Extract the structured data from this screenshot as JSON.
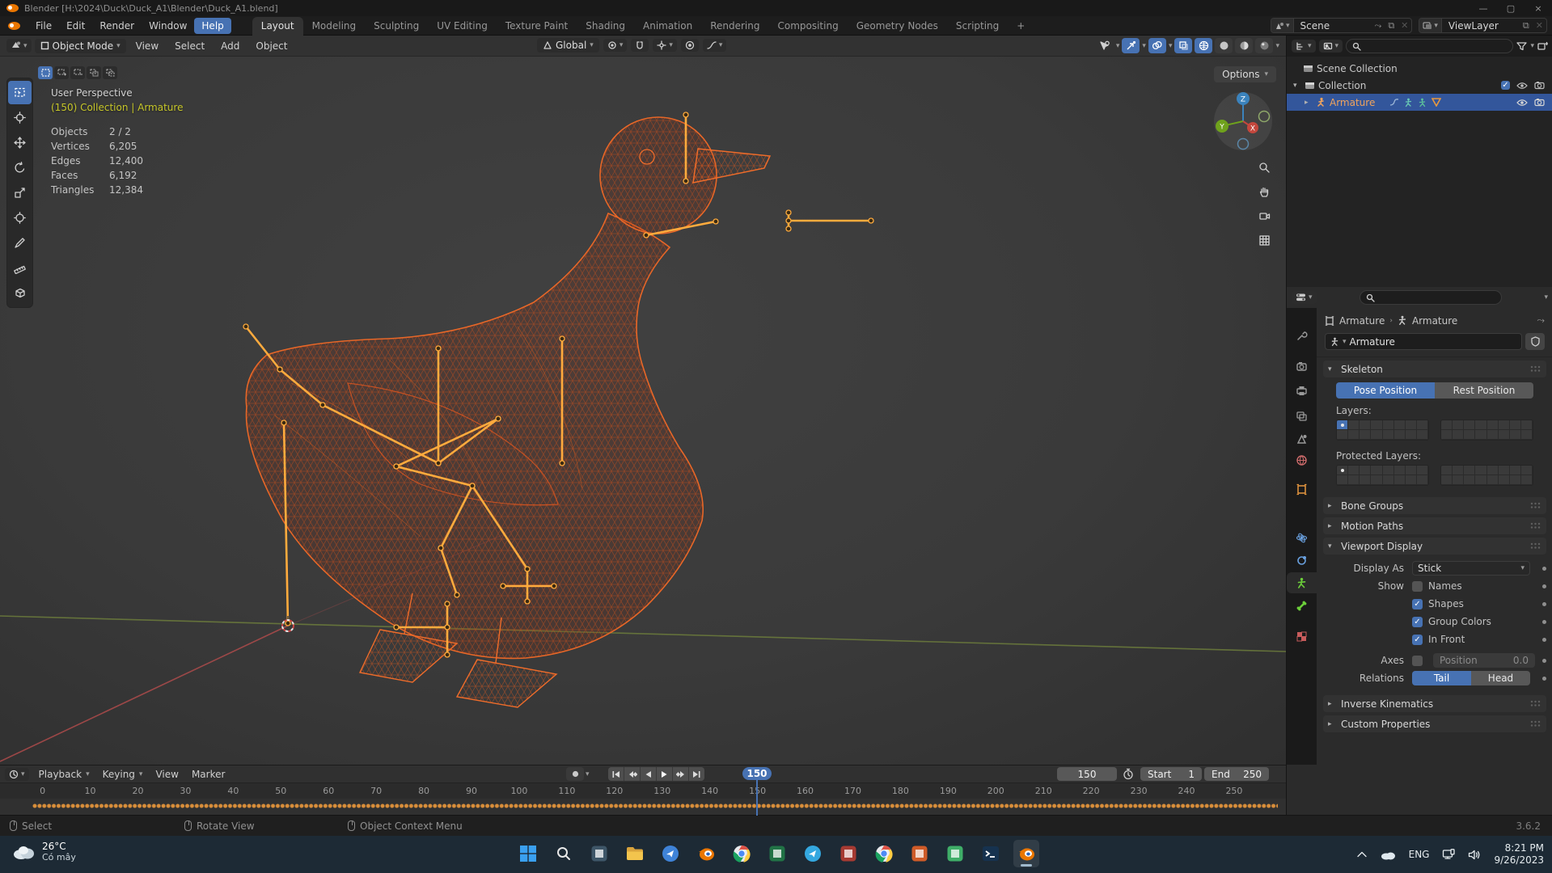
{
  "titlebar": {
    "title": "Blender [H:\\2024\\Duck\\Duck_A1\\Blender\\Duck_A1.blend]"
  },
  "topbar": {
    "menus": [
      "File",
      "Edit",
      "Render",
      "Window",
      "Help"
    ],
    "active_menu": "Help",
    "tabs": [
      "Layout",
      "Modeling",
      "Sculpting",
      "UV Editing",
      "Texture Paint",
      "Shading",
      "Animation",
      "Rendering",
      "Compositing",
      "Geometry Nodes",
      "Scripting",
      "+"
    ],
    "active_tab": "Layout",
    "scene_label": "Scene",
    "view_layer_label": "ViewLayer"
  },
  "viewport": {
    "header": {
      "mode": "Object Mode",
      "menus": [
        "View",
        "Select",
        "Add",
        "Object"
      ],
      "orientation": "Global",
      "options_label": "Options"
    },
    "overlay": {
      "perspective": "User Perspective",
      "context": "(150) Collection | Armature",
      "stats": [
        {
          "label": "Objects",
          "value": "2 / 2"
        },
        {
          "label": "Vertices",
          "value": "6,205"
        },
        {
          "label": "Edges",
          "value": "12,400"
        },
        {
          "label": "Faces",
          "value": "6,192"
        },
        {
          "label": "Triangles",
          "value": "12,384"
        }
      ]
    },
    "gizmo_axes": {
      "z": "Z",
      "y": "Y",
      "x": "X"
    }
  },
  "outliner": {
    "rows": [
      {
        "label": "Scene Collection"
      },
      {
        "label": "Collection"
      },
      {
        "label": "Armature",
        "selected": true
      }
    ]
  },
  "properties": {
    "breadcrumb": {
      "object": "Armature",
      "data": "Armature"
    },
    "name_value": "Armature",
    "skeleton": {
      "title": "Skeleton",
      "pose_label": "Pose Position",
      "rest_label": "Rest Position",
      "layers_label": "Layers:",
      "protected_label": "Protected Layers:"
    },
    "sections": {
      "bone_groups": "Bone Groups",
      "motion_paths": "Motion Paths",
      "inverse_kinematics": "Inverse Kinematics",
      "custom_properties": "Custom Properties"
    },
    "viewport_display": {
      "title": "Viewport Display",
      "display_as_label": "Display As",
      "display_as_value": "Stick",
      "show_label": "Show",
      "checkboxes": [
        {
          "label": "Names",
          "checked": false
        },
        {
          "label": "Shapes",
          "checked": true
        },
        {
          "label": "Group Colors",
          "checked": true
        },
        {
          "label": "In Front",
          "checked": true
        }
      ],
      "axes_label": "Axes",
      "position_label": "Position",
      "position_value": "0.0",
      "relations_label": "Relations",
      "tail_label": "Tail",
      "head_label": "Head"
    },
    "tabs": [
      {
        "name": "tool",
        "color": "#9a9a9a",
        "shape": "wrench"
      },
      {
        "name": "render",
        "color": "#9a9a9a",
        "shape": "camera"
      },
      {
        "name": "output",
        "color": "#9a9a9a",
        "shape": "printer"
      },
      {
        "name": "view-layer",
        "color": "#9a9a9a",
        "shape": "images"
      },
      {
        "name": "scene",
        "color": "#9a9a9a",
        "shape": "cone"
      },
      {
        "name": "world",
        "color": "#cc6a6a",
        "shape": "globe"
      },
      {
        "name": "object",
        "color": "#e8983f",
        "shape": "box"
      },
      {
        "name": "physics",
        "color": "#6aa1e0",
        "shape": "atom"
      },
      {
        "name": "constraints",
        "color": "#6aa1e0",
        "shape": "ring"
      },
      {
        "name": "object-data",
        "color": "#6ccf3a",
        "shape": "man",
        "active": true
      },
      {
        "name": "bone",
        "color": "#6ccf3a",
        "shape": "bone"
      },
      {
        "name": "texture",
        "color": "#c75b5b",
        "shape": "checker"
      }
    ]
  },
  "timeline": {
    "menus": [
      "Playback",
      "Keying",
      "View",
      "Marker"
    ],
    "current_frame": "150",
    "start_label": "Start",
    "start_value": "1",
    "end_label": "End",
    "end_value": "250",
    "playhead_frame": "150",
    "ruler": [
      "0",
      "10",
      "20",
      "30",
      "40",
      "50",
      "60",
      "70",
      "80",
      "90",
      "100",
      "110",
      "120",
      "130",
      "140",
      "150",
      "160",
      "170",
      "180",
      "190",
      "200",
      "210",
      "220",
      "230",
      "240",
      "250"
    ]
  },
  "statusbar": {
    "hints": [
      "Select",
      "Rotate View",
      "Object Context Menu"
    ],
    "version": "3.6.2"
  },
  "taskbar": {
    "weather_temp": "26°C",
    "weather_desc": "Có mây",
    "tray": {
      "lang": "ENG",
      "time": "8:21 PM",
      "date": "9/26/2023"
    },
    "apps": [
      {
        "name": "windows-start",
        "kind": "windows",
        "color": "#3aa0f0"
      },
      {
        "name": "search",
        "kind": "search",
        "color": "#e8e8e8"
      },
      {
        "name": "task-view",
        "kind": "square",
        "color": "#3e5668"
      },
      {
        "name": "file-explorer",
        "kind": "folder",
        "color": "#f3c44d"
      },
      {
        "name": "edge-browser",
        "kind": "circle",
        "color": "#3f83d8"
      },
      {
        "name": "blender",
        "kind": "blender",
        "color": "#ea7600"
      },
      {
        "name": "chrome",
        "kind": "chrome",
        "color": "#4a90e2"
      },
      {
        "name": "excel",
        "kind": "square",
        "color": "#217346"
      },
      {
        "name": "telegram",
        "kind": "circle",
        "color": "#34a8e0"
      },
      {
        "name": "app-red",
        "kind": "square",
        "color": "#a63a32"
      },
      {
        "name": "chrome-2",
        "kind": "chrome",
        "color": "#4a90e2"
      },
      {
        "name": "app-orange",
        "kind": "square",
        "color": "#cf5b28"
      },
      {
        "name": "app-green",
        "kind": "square",
        "color": "#3fae68"
      },
      {
        "name": "terminal",
        "kind": "terminal",
        "color": "#16324f"
      },
      {
        "name": "blender-2",
        "kind": "blender",
        "color": "#ea7600",
        "active": true
      }
    ]
  },
  "colors": {
    "accent_blue": "#4772b3",
    "selection_blue": "#33569b",
    "wire_orange": "#e0561f",
    "bone_orange": "#ffab3d",
    "keyframe_orange": "#d98e3a",
    "context_yellow": "#c7c729"
  }
}
